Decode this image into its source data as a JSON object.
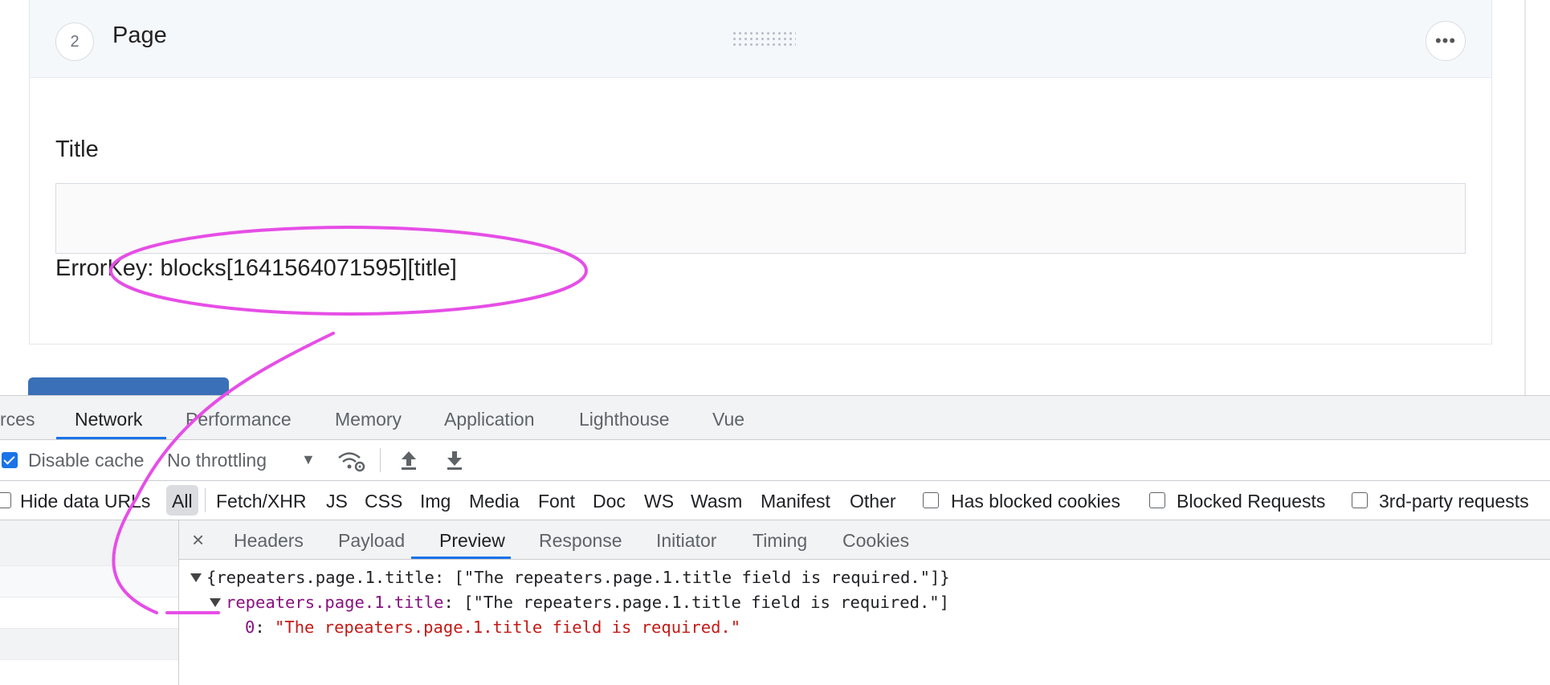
{
  "block": {
    "step_number": "2",
    "title": "Page",
    "more_glyph": "•••",
    "field_label": "Title",
    "title_value": "",
    "error_key": "ErrorKey: blocks[1641564071595][title]"
  },
  "devtools": {
    "main_tabs": [
      {
        "label": "rces"
      },
      {
        "label": "Network",
        "active": true
      },
      {
        "label": "Performance"
      },
      {
        "label": "Memory"
      },
      {
        "label": "Application"
      },
      {
        "label": "Lighthouse"
      },
      {
        "label": "Vue"
      }
    ],
    "toolbar": {
      "disable_cache_label": "Disable cache",
      "disable_cache_checked": true,
      "throttling_value": "No throttling",
      "dropdown_glyph": "▼"
    },
    "filters": {
      "hide_data_urls": "Hide data URLs",
      "types": [
        "All",
        "Fetch/XHR",
        "JS",
        "CSS",
        "Img",
        "Media",
        "Font",
        "Doc",
        "WS",
        "Wasm",
        "Manifest",
        "Other"
      ],
      "selected": "All",
      "has_blocked_cookies": "Has blocked cookies",
      "blocked_requests": "Blocked Requests",
      "third_party": "3rd-party requests"
    },
    "detail": {
      "close_glyph": "×",
      "tabs": [
        "Headers",
        "Payload",
        "Preview",
        "Response",
        "Initiator",
        "Timing",
        "Cookies"
      ],
      "active_tab": "Preview"
    },
    "preview": {
      "line1": "{repeaters.page.1.title: [\"The repeaters.page.1.title field is required.\"]}",
      "key2": "repeaters.page.1.title",
      "rest2": ": [\"The repeaters.page.1.title field is required.\"]",
      "index3": "0",
      "colon3": ": ",
      "value3": "\"The repeaters.page.1.title field is required.\""
    }
  },
  "colors": {
    "annotation": "#e64ee6",
    "accent": "#1a73e8",
    "string_red": "#c41a16",
    "key_purple": "#881280"
  }
}
